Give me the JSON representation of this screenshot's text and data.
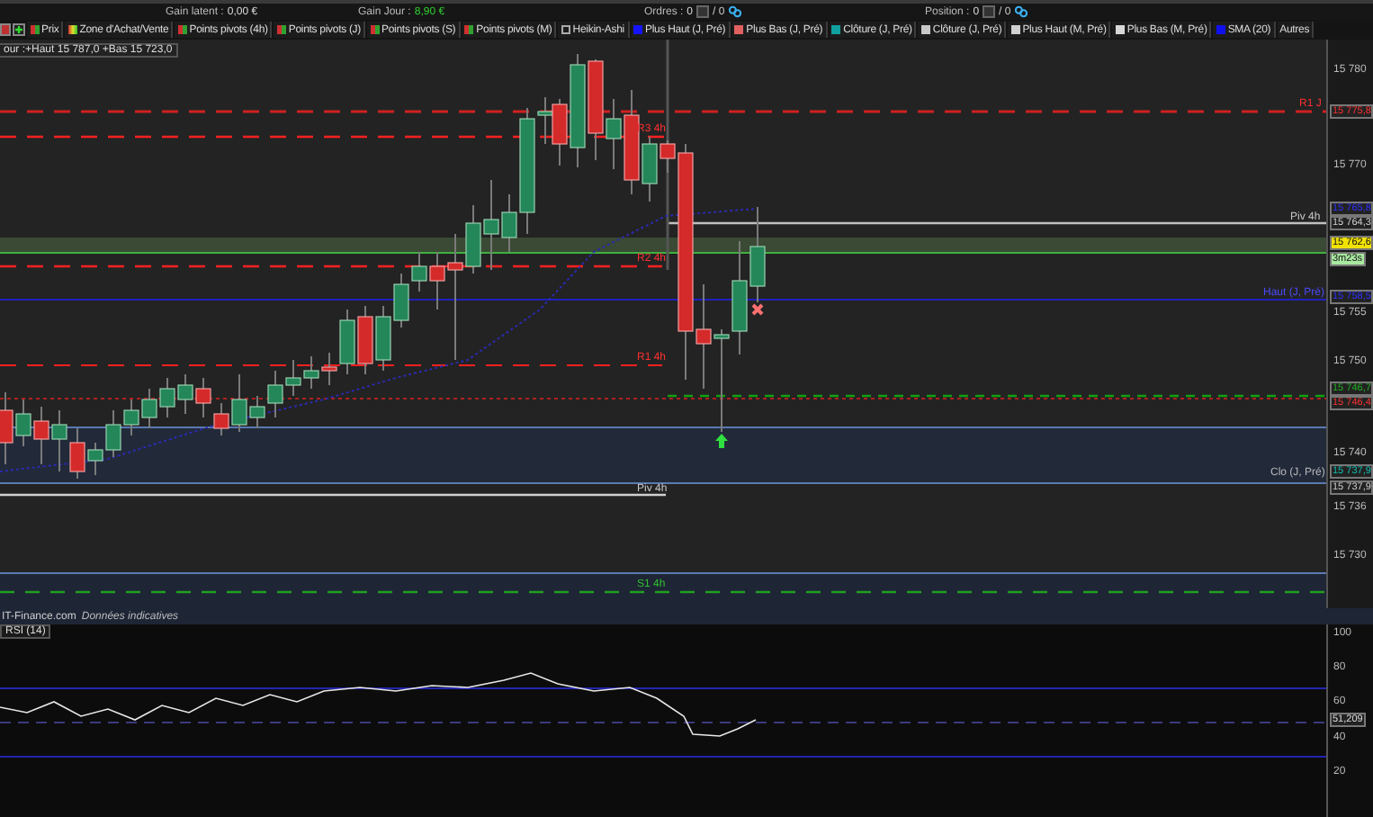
{
  "account_bar": {
    "stats": [
      {
        "label": "Gain latent :",
        "value": "0,00 €",
        "kind": "plain"
      },
      {
        "label": "Gain Jour :",
        "value": "8,90 €",
        "kind": "gain"
      },
      {
        "label": "Ordres :",
        "value": "0",
        "total": "/ 0",
        "kind": "count"
      },
      {
        "label": "Position :",
        "value": "0",
        "total": "/ 0",
        "kind": "count"
      }
    ]
  },
  "legend": {
    "items": [
      {
        "label": "Prix",
        "kind": "split"
      },
      {
        "label": "Zone d'Achat/Vente",
        "kind": "multi"
      },
      {
        "label": "Points pivots (4h)",
        "kind": "split"
      },
      {
        "label": "Points pivots (J)",
        "kind": "split"
      },
      {
        "label": "Points pivots (S)",
        "kind": "split"
      },
      {
        "label": "Points pivots (M)",
        "kind": "split"
      },
      {
        "label": "Heikin-Ashi",
        "kind": "empty"
      },
      {
        "label": "Plus Haut (J, Pré)",
        "kind": "solid",
        "color": "#1414ff"
      },
      {
        "label": "Plus Bas (J, Pré)",
        "kind": "solid",
        "color": "#e06060"
      },
      {
        "label": "Clôture (J, Pré)",
        "kind": "solid",
        "color": "#10a0a0"
      },
      {
        "label": "Clôture (J, Pré)",
        "kind": "solid",
        "color": "#c8c8c8"
      },
      {
        "label": "Plus Haut (M, Pré)",
        "kind": "solid",
        "color": "#d0d0d0"
      },
      {
        "label": "Plus Bas (M, Pré)",
        "kind": "solid",
        "color": "#d8d8d8"
      },
      {
        "label": "SMA (20)",
        "kind": "solid",
        "color": "#1010ee"
      },
      {
        "label": "Autres",
        "kind": "plain"
      }
    ]
  },
  "info_box": {
    "text": "our :+Haut 15 787,0 +Bas 15 723,0"
  },
  "line_labels": [
    {
      "text": "R1 J",
      "kind": "resistance"
    },
    {
      "text": "Piv 4h",
      "kind": "pivot"
    },
    {
      "text": "Haut (J, Pré)",
      "kind": "high"
    },
    {
      "text": "Clo (J, Pré)",
      "kind": "close"
    },
    {
      "text": "R3 4h",
      "kind": "resistance"
    },
    {
      "text": "R2 4h",
      "kind": "resistance"
    },
    {
      "text": "R1 4h",
      "kind": "resistance"
    },
    {
      "text": "Piv 4h",
      "kind": "pivot"
    },
    {
      "text": "S1 4h",
      "kind": "support"
    }
  ],
  "price_axis": {
    "ticks": [
      "15 780",
      "15 770",
      "15 755",
      "15 750",
      "15 740",
      "15 736",
      "15 730"
    ],
    "markers": [
      {
        "text": "15 775,8",
        "kind": "outline",
        "color": "#ff3030"
      },
      {
        "text": "15 765,8",
        "kind": "outline",
        "color": "#3030ff"
      },
      {
        "text": "15 764,3",
        "kind": "outline",
        "color": "#d0d0d0"
      },
      {
        "text": "15 762,6",
        "kind": "filled",
        "color": "#f2e200"
      },
      {
        "text": "3m23s",
        "kind": "filled",
        "color": "#a8e8a0"
      },
      {
        "text": "15 758,5",
        "kind": "outline",
        "color": "#3030ff"
      },
      {
        "text": "15 746,7",
        "kind": "outline",
        "color": "#20b020"
      },
      {
        "text": "15 746,4",
        "kind": "outline",
        "color": "#ff3030"
      },
      {
        "text": "15 737,9",
        "kind": "outline",
        "color": "#10c0b0"
      },
      {
        "text": "15 737,9",
        "kind": "outline",
        "color": "#d0d0d0"
      }
    ]
  },
  "footer": {
    "source": "IT-Finance.com",
    "note": "Données indicatives"
  },
  "rsi": {
    "label": "RSI (14)",
    "ticks": [
      "100",
      "80",
      "60",
      "40",
      "20"
    ],
    "marker": "51,209"
  }
}
